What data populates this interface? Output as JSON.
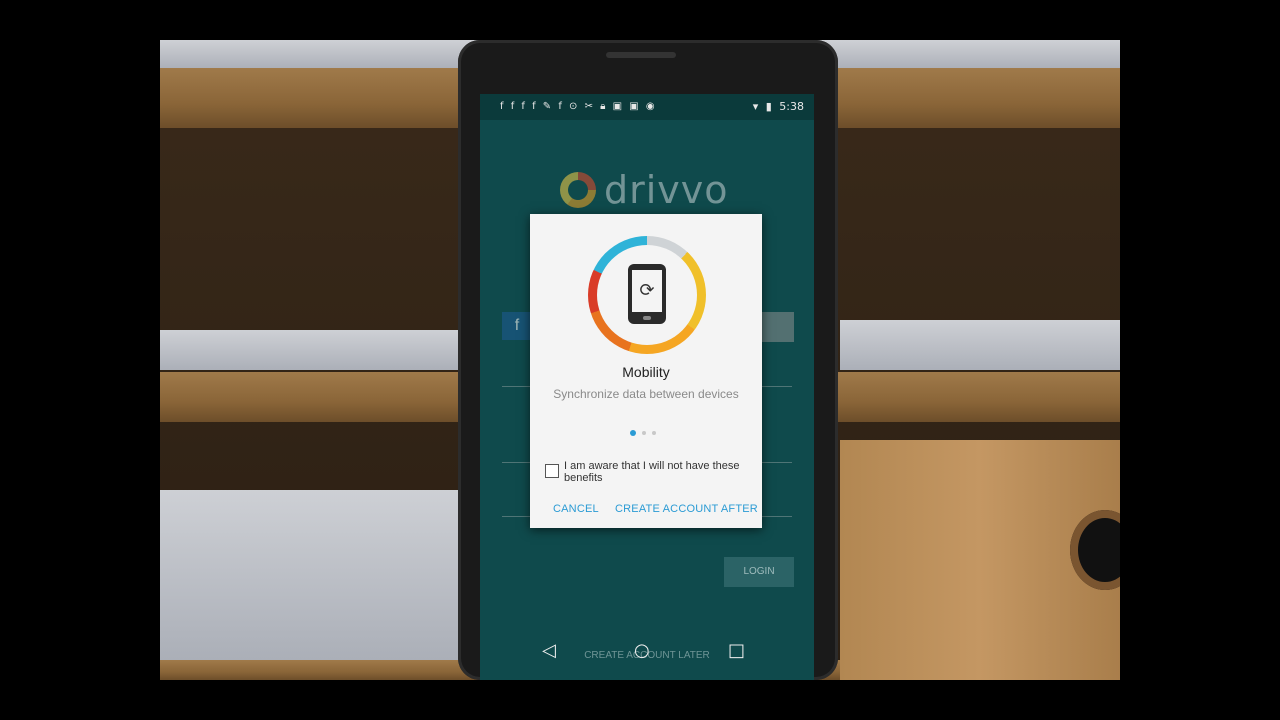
{
  "status_bar": {
    "time": "5:38",
    "notification_icons": [
      "facebook-icon",
      "facebook-icon",
      "facebook-icon",
      "facebook-icon",
      "wrench-icon",
      "facebook-icon",
      "alarm-icon",
      "no-signal-icon",
      "lock-icon",
      "camera-icon",
      "camera-icon",
      "robot-icon"
    ],
    "right_icons": [
      "wifi-icon",
      "data-icon",
      "battery-icon"
    ]
  },
  "app": {
    "brand": "drivvo",
    "background_login_button": "LOGIN",
    "background_create_later": "CREATE ACCOUNT LATER"
  },
  "dialog": {
    "title": "Mobility",
    "subtitle": "Synchronize data between devices",
    "page_dots": 3,
    "active_dot": 1,
    "checkbox_label": "I am aware that I will not have these benefits",
    "checkbox_checked": false,
    "cancel_label": "CANCEL",
    "create_label": "CREATE ACCOUNT AFTER",
    "icon": "phone-sync-icon",
    "accent_color": "#2b9bd4"
  },
  "nav": {
    "back": "back-icon",
    "home": "home-icon",
    "recents": "recents-icon"
  }
}
